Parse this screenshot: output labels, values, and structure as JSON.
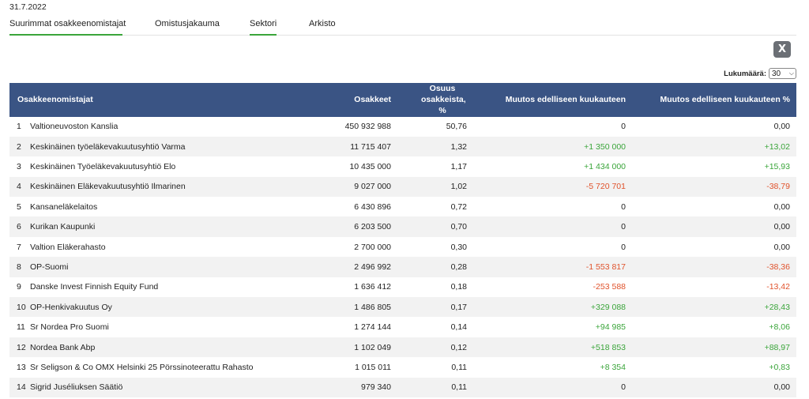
{
  "date": "31.7.2022",
  "tabs": [
    {
      "label": "Suurimmat osakkeenomistajat",
      "active": true
    },
    {
      "label": "Omistusjakauma",
      "active": false
    },
    {
      "label": "Sektori",
      "active": true
    },
    {
      "label": "Arkisto",
      "active": false
    }
  ],
  "excel_icon": "X",
  "count": {
    "label": "Lukumäärä:",
    "value": "30"
  },
  "table": {
    "headers": [
      "Osakkeenomistajat",
      "Osakkeet",
      "Osuus osakkeista, %",
      "Muutos edelliseen kuukauteen",
      "Muutos edelliseen kuukauteen %"
    ],
    "rows": [
      {
        "rank": "1",
        "name": "Valtioneuvoston Kanslia",
        "shares": "450 932 988",
        "pct": "50,76",
        "change": "0",
        "change_pct": "0,00",
        "trend": "neu"
      },
      {
        "rank": "2",
        "name": "Keskinäinen työeläkevakuutusyhtiö Varma",
        "shares": "11 715 407",
        "pct": "1,32",
        "change": "+1 350 000",
        "change_pct": "+13,02",
        "trend": "pos"
      },
      {
        "rank": "3",
        "name": "Keskinäinen Työeläkevakuutusyhtiö Elo",
        "shares": "10 435 000",
        "pct": "1,17",
        "change": "+1 434 000",
        "change_pct": "+15,93",
        "trend": "pos"
      },
      {
        "rank": "4",
        "name": "Keskinäinen Eläkevakuutusyhtiö Ilmarinen",
        "shares": "9 027 000",
        "pct": "1,02",
        "change": "-5 720 701",
        "change_pct": "-38,79",
        "trend": "neg"
      },
      {
        "rank": "5",
        "name": "Kansaneläkelaitos",
        "shares": "6 430 896",
        "pct": "0,72",
        "change": "0",
        "change_pct": "0,00",
        "trend": "neu"
      },
      {
        "rank": "6",
        "name": "Kurikan Kaupunki",
        "shares": "6 203 500",
        "pct": "0,70",
        "change": "0",
        "change_pct": "0,00",
        "trend": "neu"
      },
      {
        "rank": "7",
        "name": "Valtion Eläkerahasto",
        "shares": "2 700 000",
        "pct": "0,30",
        "change": "0",
        "change_pct": "0,00",
        "trend": "neu"
      },
      {
        "rank": "8",
        "name": "OP-Suomi",
        "shares": "2 496 992",
        "pct": "0,28",
        "change": "-1 553 817",
        "change_pct": "-38,36",
        "trend": "neg"
      },
      {
        "rank": "9",
        "name": "Danske Invest Finnish Equity Fund",
        "shares": "1 636 412",
        "pct": "0,18",
        "change": "-253 588",
        "change_pct": "-13,42",
        "trend": "neg"
      },
      {
        "rank": "10",
        "name": "OP-Henkivakuutus Oy",
        "shares": "1 486 805",
        "pct": "0,17",
        "change": "+329 088",
        "change_pct": "+28,43",
        "trend": "pos"
      },
      {
        "rank": "11",
        "name": "Sr Nordea Pro Suomi",
        "shares": "1 274 144",
        "pct": "0,14",
        "change": "+94 985",
        "change_pct": "+8,06",
        "trend": "pos"
      },
      {
        "rank": "12",
        "name": "Nordea Bank Abp",
        "shares": "1 102 049",
        "pct": "0,12",
        "change": "+518 853",
        "change_pct": "+88,97",
        "trend": "pos"
      },
      {
        "rank": "13",
        "name": "Sr Seligson & Co OMX Helsinki 25 Pörssinoteerattu Rahasto",
        "shares": "1 015 011",
        "pct": "0,11",
        "change": "+8 354",
        "change_pct": "+0,83",
        "trend": "pos"
      },
      {
        "rank": "14",
        "name": "Sigrid Juséliuksen Säätiö",
        "shares": "979 340",
        "pct": "0,11",
        "change": "0",
        "change_pct": "0,00",
        "trend": "neu"
      }
    ]
  },
  "colors": {
    "header_bg": "#3a5484",
    "positive": "#3aa53a",
    "negative": "#e0522b",
    "tab_underline": "#3aa53a"
  }
}
